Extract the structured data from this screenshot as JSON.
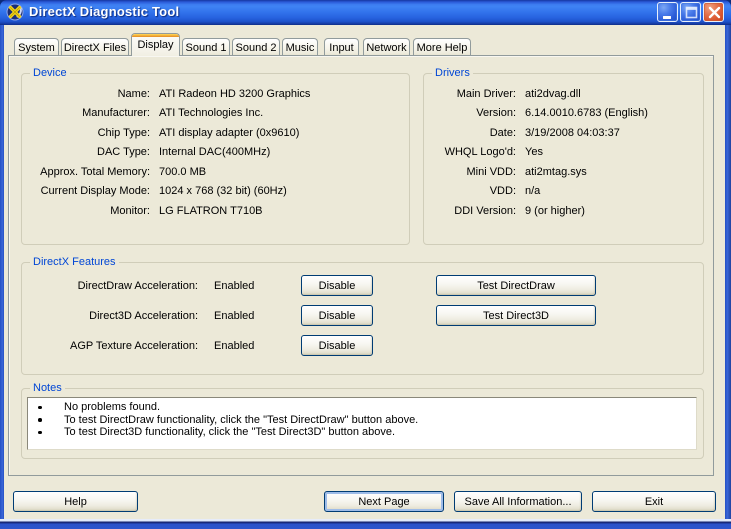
{
  "window": {
    "title": "DirectX Diagnostic Tool",
    "controls": [
      "minimize",
      "maximize",
      "close"
    ]
  },
  "colors": {
    "titlebar_blue": "#3273ec",
    "client_beige": "#ece9d8",
    "group_caption_blue": "#0046d5",
    "active_tab_accent": "#e08828",
    "close_button_red": "#d8512a"
  },
  "tabs": {
    "active": "Display",
    "items": [
      {
        "label": "System"
      },
      {
        "label": "DirectX Files"
      },
      {
        "label": "Display"
      },
      {
        "label": "Sound 1"
      },
      {
        "label": "Sound 2"
      },
      {
        "label": "Music"
      },
      {
        "label": "Input"
      },
      {
        "label": "Network"
      },
      {
        "label": "More Help"
      }
    ]
  },
  "device": {
    "caption": "Device",
    "rows": [
      {
        "label": "Name:",
        "value": "ATI Radeon HD 3200 Graphics"
      },
      {
        "label": "Manufacturer:",
        "value": "ATI Technologies Inc."
      },
      {
        "label": "Chip Type:",
        "value": "ATI display adapter (0x9610)"
      },
      {
        "label": "DAC Type:",
        "value": "Internal DAC(400MHz)"
      },
      {
        "label": "Approx. Total Memory:",
        "value": "700.0 MB"
      },
      {
        "label": "Current Display Mode:",
        "value": "1024 x 768 (32 bit) (60Hz)"
      },
      {
        "label": "Monitor:",
        "value": "LG FLATRON T710B"
      }
    ]
  },
  "drivers": {
    "caption": "Drivers",
    "rows": [
      {
        "label": "Main Driver:",
        "value": "ati2dvag.dll"
      },
      {
        "label": "Version:",
        "value": "6.14.0010.6783 (English)"
      },
      {
        "label": "Date:",
        "value": "3/19/2008 04:03:37"
      },
      {
        "label": "WHQL Logo'd:",
        "value": "Yes"
      },
      {
        "label": "Mini VDD:",
        "value": "ati2mtag.sys"
      },
      {
        "label": "VDD:",
        "value": "n/a"
      },
      {
        "label": "DDI Version:",
        "value": "9 (or higher)"
      }
    ]
  },
  "features": {
    "caption": "DirectX Features",
    "rows": [
      {
        "label": "DirectDraw Acceleration:",
        "status": "Enabled",
        "action": "Disable",
        "test": "Test DirectDraw"
      },
      {
        "label": "Direct3D Acceleration:",
        "status": "Enabled",
        "action": "Disable",
        "test": "Test Direct3D"
      },
      {
        "label": "AGP Texture Acceleration:",
        "status": "Enabled",
        "action": "Disable",
        "test": ""
      }
    ]
  },
  "notes": {
    "caption": "Notes",
    "items": [
      "No problems found.",
      "To test DirectDraw functionality, click the \"Test DirectDraw\" button above.",
      "To test Direct3D functionality, click the \"Test Direct3D\" button above."
    ]
  },
  "footer": {
    "help": "Help",
    "next_page": "Next Page",
    "save_all": "Save All Information...",
    "exit": "Exit"
  }
}
